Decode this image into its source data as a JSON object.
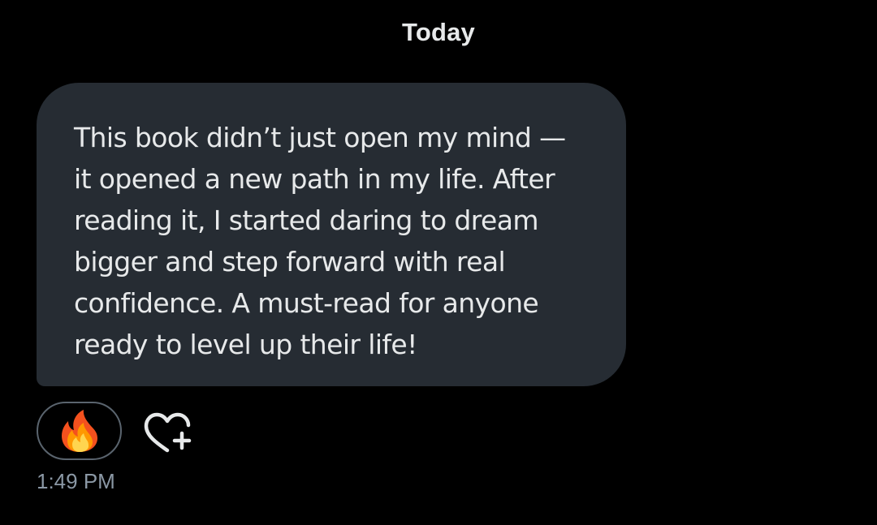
{
  "conversation": {
    "date_separator": "Today"
  },
  "message": {
    "lines": [
      "This book didn’t just open my mind —",
      "it opened a new path in my life. After",
      "reading it, I started daring to dream",
      "bigger and step forward with real",
      "confidence. A must-read for anyone",
      "ready to level up their life!"
    ],
    "timestamp": "1:49 PM",
    "reaction": {
      "icon": "fire-emoji-icon",
      "emoji": "🔥"
    },
    "add_reaction": {
      "icon": "heart-plus-icon"
    }
  },
  "colors": {
    "background": "#000000",
    "bubble": "#262c33",
    "text": "#e7e9ea",
    "muted": "#8b98a5",
    "pill_border": "#5a646e"
  }
}
